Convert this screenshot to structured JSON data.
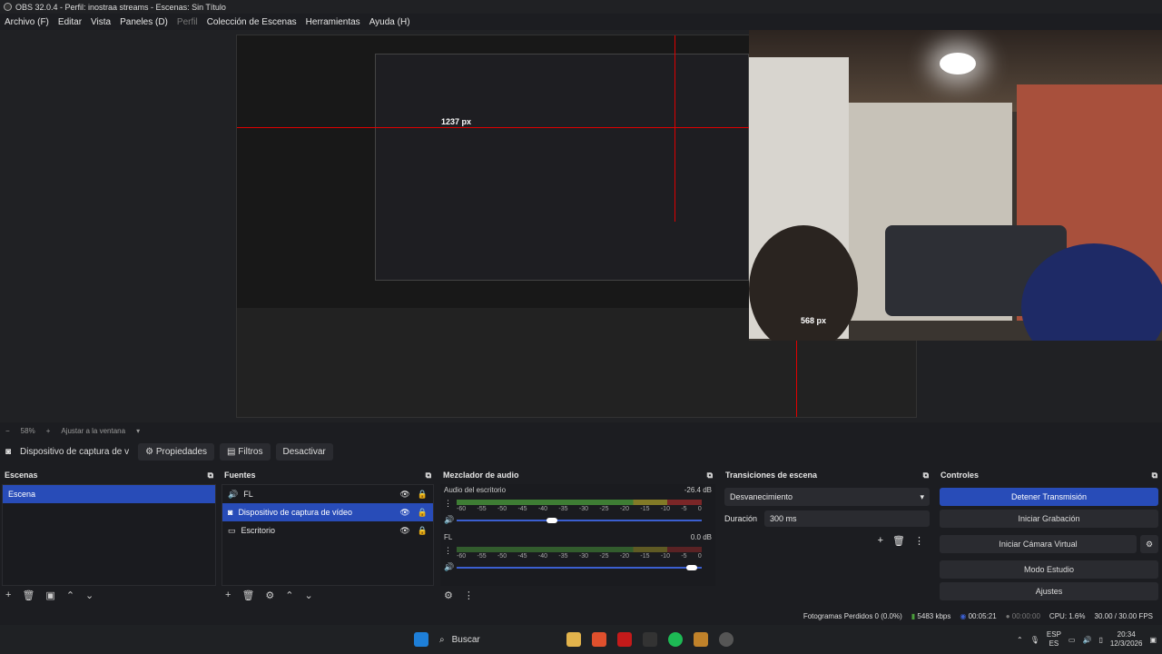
{
  "window": {
    "title": "OBS 32.0.4 - Perfil: inostraa streams - Escenas: Sin Título"
  },
  "menu": [
    {
      "label": "Archivo (F)",
      "dim": false
    },
    {
      "label": "Editar",
      "dim": false
    },
    {
      "label": "Vista",
      "dim": false
    },
    {
      "label": "Paneles (D)",
      "dim": false
    },
    {
      "label": "Perfil",
      "dim": true
    },
    {
      "label": "Colección de Escenas",
      "dim": false
    },
    {
      "label": "Herramientas",
      "dim": false
    },
    {
      "label": "Ayuda (H)",
      "dim": false
    }
  ],
  "preview": {
    "measure_h_label": "1237 px",
    "measure_v_label": "568 px"
  },
  "zoom": {
    "level": "58%",
    "fit_label": "Ajustar a la ventana"
  },
  "source_toolbar": {
    "source_name": "Dispositivo de captura de v",
    "properties": "Propiedades",
    "filters": "Filtros",
    "deactivate": "Desactivar"
  },
  "scenes": {
    "title": "Escenas",
    "items": [
      "Escena"
    ]
  },
  "sources": {
    "title": "Fuentes",
    "items": [
      {
        "label": "FL",
        "icon": "speaker-icon"
      },
      {
        "label": "Dispositivo de captura de vídeo",
        "icon": "camera-icon"
      },
      {
        "label": "Escritorio",
        "icon": "monitor-icon"
      }
    ]
  },
  "mixer": {
    "title": "Mezclador de audio",
    "ticks": [
      "-60",
      "-55",
      "-50",
      "-45",
      "-40",
      "-35",
      "-30",
      "-25",
      "-20",
      "-15",
      "-10",
      "-5",
      "0"
    ],
    "tracks": [
      {
        "name": "Audio del escritorio",
        "db": "-26.4 dB",
        "volume": 0.39
      },
      {
        "name": "FL",
        "db": "0.0 dB",
        "volume": 0.96
      }
    ]
  },
  "transitions": {
    "title": "Transiciones de escena",
    "selected": "Desvanecimiento",
    "duration_label": "Duración",
    "duration_value": "300 ms"
  },
  "controls": {
    "title": "Controles",
    "stop_stream": "Detener Transmisión",
    "start_record": "Iniciar Grabación",
    "start_vcam": "Iniciar Cámara Virtual",
    "studio_mode": "Modo Estudio",
    "settings": "Ajustes"
  },
  "status": {
    "dropped_frames": "Fotogramas Perdidos 0 (0.0%)",
    "bitrate": "5483 kbps",
    "stream_time": "00:05:21",
    "record_time": "00:00:00",
    "cpu": "CPU: 1.6%",
    "fps": "30.00 / 30.00 FPS"
  },
  "taskbar": {
    "search": "Buscar",
    "lang_top": "ESP",
    "lang_bottom": "ES",
    "time": "20:34",
    "date": "12/3/2026"
  },
  "colors": {
    "accent": "#284cb8",
    "measure": "#e00000",
    "meter_green": "#4a9e3b"
  }
}
